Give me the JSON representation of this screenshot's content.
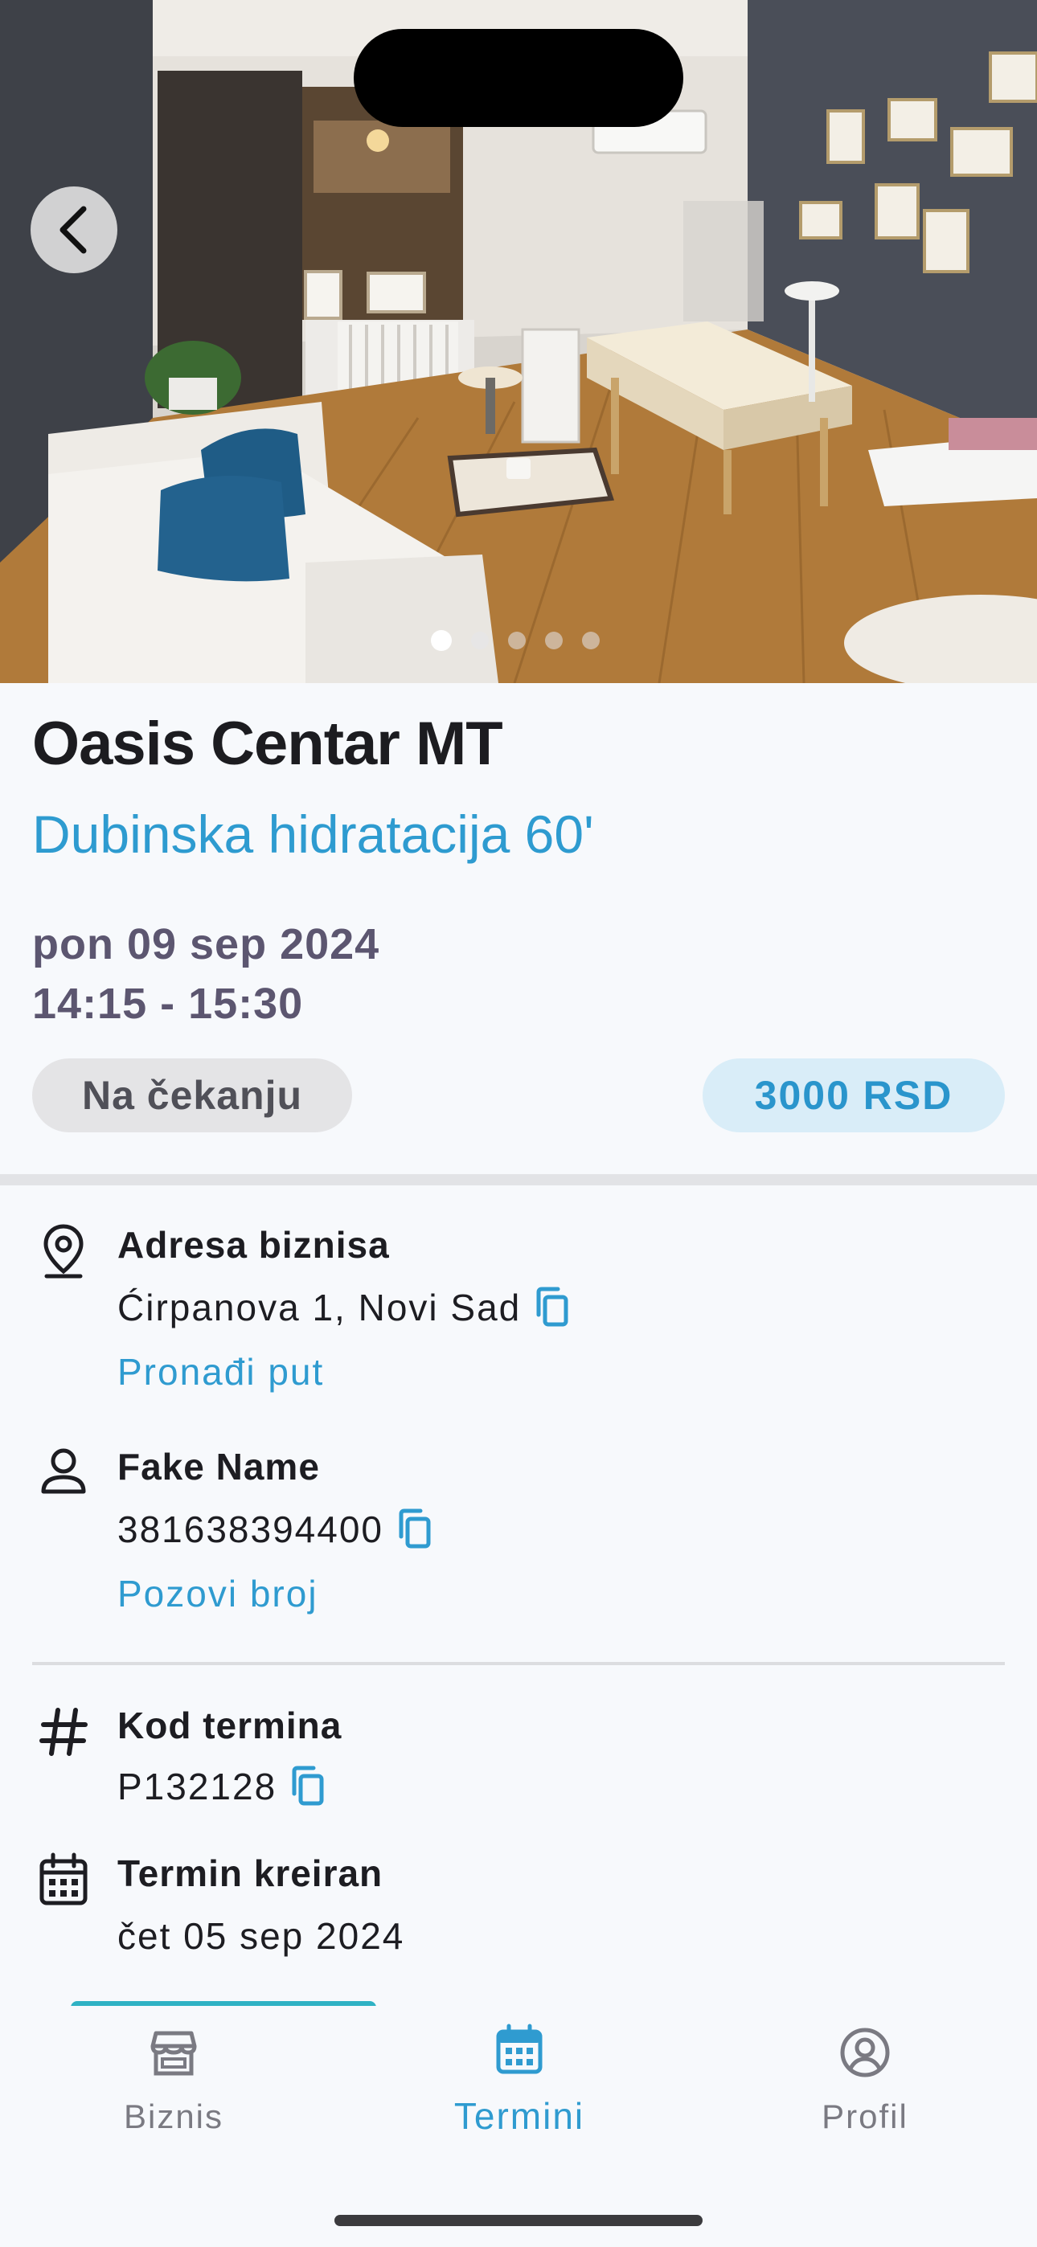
{
  "gallery": {
    "image_count": 5,
    "active_index": 0,
    "back_icon": "chevron-left-icon"
  },
  "business": {
    "name": "Oasis Centar MT",
    "service": "Dubinska hidratacija 60'"
  },
  "appointment": {
    "date": "pon 09 sep 2024",
    "time": "14:15 - 15:30",
    "status": "Na čekanju",
    "price": "3000 RSD"
  },
  "details": {
    "address": {
      "icon": "location-pin-icon",
      "title": "Adresa biznisa",
      "value": "Ćirpanova 1, Novi Sad",
      "link": "Pronađi put"
    },
    "contact": {
      "icon": "person-icon",
      "title": "Fake Name",
      "value": "381638394400",
      "link": "Pozovi broj"
    },
    "code": {
      "icon": "hash-icon",
      "title": "Kod termina",
      "value": "P132128"
    },
    "created": {
      "icon": "calendar-icon",
      "title": "Termin kreiran",
      "value": "čet 05 sep 2024"
    }
  },
  "nav": {
    "items": [
      {
        "label": "Biznis",
        "icon": "store-icon",
        "active": false
      },
      {
        "label": "Termini",
        "icon": "calendar-icon",
        "active": true
      },
      {
        "label": "Profil",
        "icon": "profile-circle-icon",
        "active": false
      }
    ]
  },
  "colors": {
    "accent": "#2F9BD0",
    "background": "#F7F9FC",
    "status_pill_bg": "#E4E4E6",
    "price_pill_bg": "#D9EDF8",
    "secondary_text": "#5C5670"
  }
}
